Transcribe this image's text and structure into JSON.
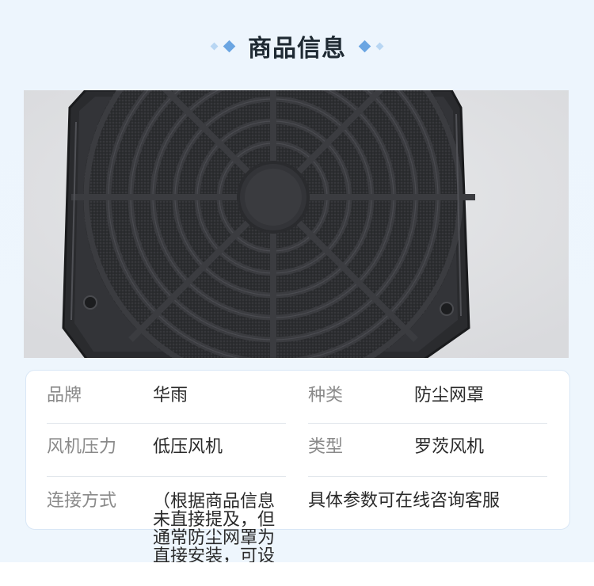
{
  "section_title": "商品信息",
  "image_alt": "防尘网罩产品图",
  "specs": {
    "brand": {
      "label": "品牌",
      "value": "华雨"
    },
    "category": {
      "label": "种类",
      "value": "防尘网罩"
    },
    "fan_pressure": {
      "label": "风机压力",
      "value": "低压风机"
    },
    "type": {
      "label": "类型",
      "value": "罗茨风机"
    },
    "connection": {
      "label": "连接方式",
      "value": "（根据商品信息未直接提及，但通常防尘网罩为直接安装，可设定为）直接安装"
    },
    "note": "具体参数可在线咨询客服"
  },
  "colors": {
    "accent": "#6aa5e2",
    "accent_light": "#b8d6f3",
    "background": "#edf5fd",
    "card_border": "#d9e7f6"
  }
}
